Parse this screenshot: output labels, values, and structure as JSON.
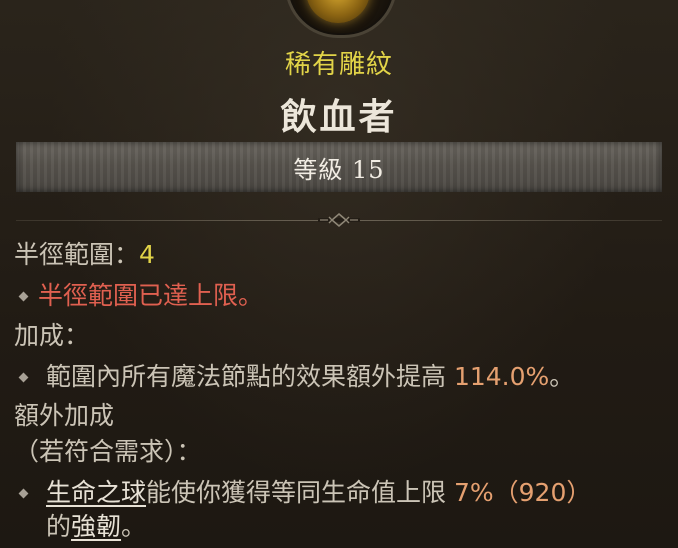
{
  "tooltip": {
    "rarity": "稀有雕紋",
    "name": "飲血者",
    "level_label": "等級 15",
    "radius": {
      "label": "半徑範圍：",
      "value": "4"
    },
    "radius_max_note": "半徑範圍已達上限。",
    "bonus_header": "加成：",
    "bonus": {
      "text": "範圍內所有魔法節點的效果額外提高 ",
      "value": "114.0%",
      "suffix": "。"
    },
    "additional_header": "額外加成",
    "requirement_note": "（若符合需求）：",
    "additional": {
      "link1": "生命之球",
      "text1": "能使你獲得等同生命值上限 ",
      "value": "7%（920）",
      "text2": "的",
      "link2": "強韌",
      "suffix": "。"
    },
    "colors": {
      "rarity": "#e2d448",
      "warning": "#e06050",
      "number": "#e5a070",
      "text": "#cbc4b6"
    }
  }
}
